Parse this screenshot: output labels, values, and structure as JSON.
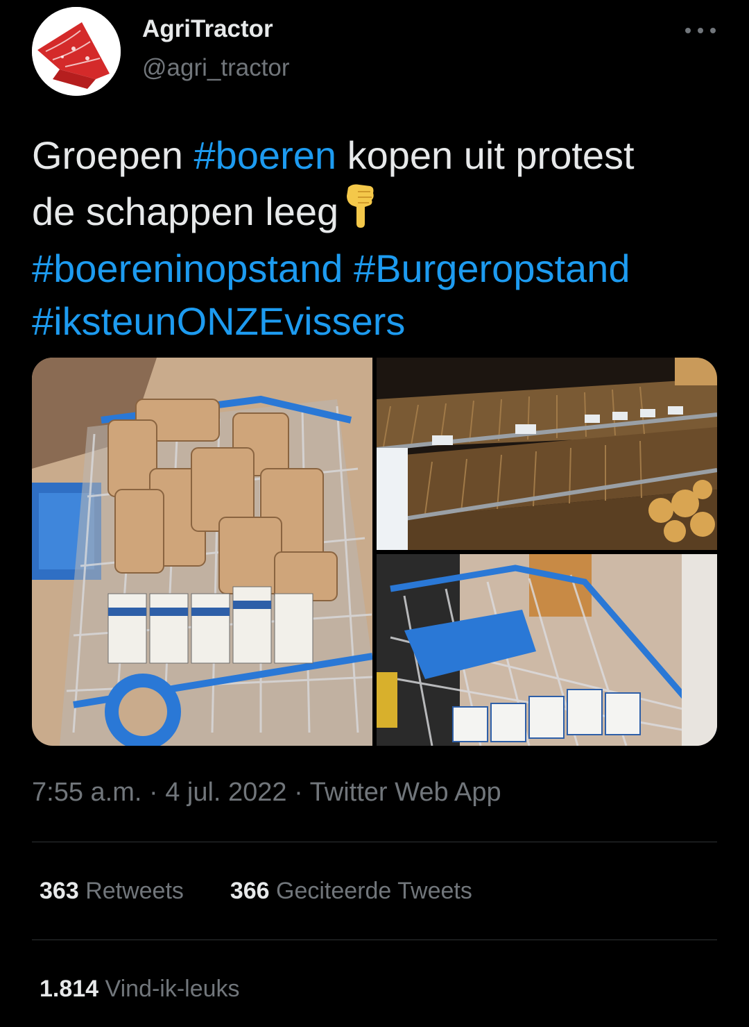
{
  "author": {
    "display_name": "AgriTractor",
    "handle": "@agri_tractor",
    "avatar_icon": "red-bandana-icon"
  },
  "more_icon": "more-dots-icon",
  "tweet": {
    "line1_a": "Groepen ",
    "tag_boeren": "#boeren",
    "line1_b": " kopen uit protest",
    "line2": "de schappen leeg",
    "emoji": "pointing-down-hand-icon",
    "tag_opstand": "#boereninopstand",
    "tag_burger": "#Burgeropstand",
    "tag_vissers": "#iksteunONZEvissers",
    "link_color": "#1d9bf0"
  },
  "media": {
    "photos": [
      {
        "name": "shopping-cart-full-of-eggs-and-milk"
      },
      {
        "name": "empty-bread-shelves"
      },
      {
        "name": "shopping-cart-with-milk"
      }
    ]
  },
  "meta": {
    "time": "7:55 a.m.",
    "sep1": " · ",
    "date": "4 jul. 2022",
    "sep2": " · ",
    "source": "Twitter Web App"
  },
  "stats": {
    "retweets_count": "363",
    "retweets_label": "Retweets",
    "quotes_count": "366",
    "quotes_label": "Geciteerde Tweets",
    "likes_count": "1.814",
    "likes_label": "Vind-ik-leuks"
  }
}
